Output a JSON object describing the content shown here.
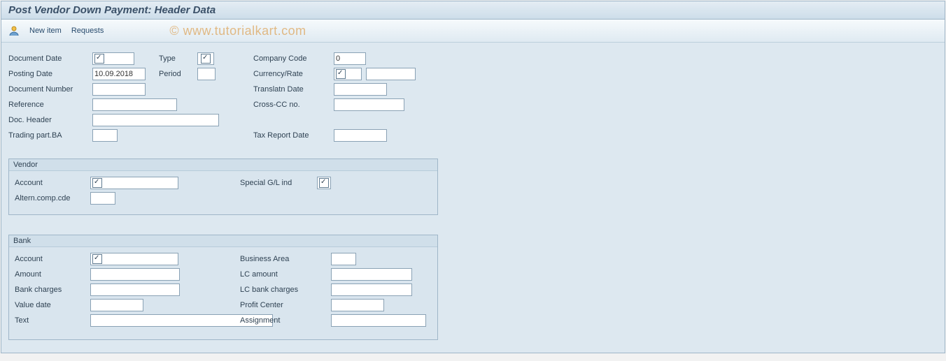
{
  "title": "Post Vendor Down Payment: Header Data",
  "watermark": "© www.tutorialkart.com",
  "toolbar": {
    "new_item": "New item",
    "requests": "Requests"
  },
  "header": {
    "document_date": {
      "label": "Document Date",
      "value": "",
      "checked": true
    },
    "posting_date": {
      "label": "Posting Date",
      "value": "10.09.2018"
    },
    "document_number": {
      "label": "Document Number",
      "value": ""
    },
    "reference": {
      "label": "Reference",
      "value": ""
    },
    "doc_header": {
      "label": "Doc. Header",
      "value": ""
    },
    "trading_part_ba": {
      "label": "Trading part.BA",
      "value": ""
    },
    "type": {
      "label": "Type",
      "value": "",
      "checked": true
    },
    "period": {
      "label": "Period",
      "value": ""
    },
    "company_code": {
      "label": "Company Code",
      "value": "0"
    },
    "currency_rate": {
      "label": "Currency/Rate",
      "value": "",
      "checked": true,
      "value2": ""
    },
    "translatn_date": {
      "label": "Translatn Date",
      "value": ""
    },
    "cross_cc_no": {
      "label": "Cross-CC no.",
      "value": ""
    },
    "tax_report_date": {
      "label": "Tax Report Date",
      "value": ""
    }
  },
  "vendor": {
    "title": "Vendor",
    "account": {
      "label": "Account",
      "value": "",
      "checked": true
    },
    "altern_comp_cde": {
      "label": "Altern.comp.cde",
      "value": ""
    },
    "special_gl_ind": {
      "label": "Special G/L ind",
      "value": "",
      "checked": true
    }
  },
  "bank": {
    "title": "Bank",
    "account": {
      "label": "Account",
      "value": "",
      "checked": true
    },
    "amount": {
      "label": "Amount",
      "value": ""
    },
    "bank_charges": {
      "label": "Bank charges",
      "value": ""
    },
    "value_date": {
      "label": "Value date",
      "value": ""
    },
    "text": {
      "label": "Text",
      "value": ""
    },
    "business_area": {
      "label": "Business Area",
      "value": ""
    },
    "lc_amount": {
      "label": "LC amount",
      "value": ""
    },
    "lc_bank_charges": {
      "label": "LC bank charges",
      "value": ""
    },
    "profit_center": {
      "label": "Profit Center",
      "value": ""
    },
    "assignment": {
      "label": "Assignment",
      "value": ""
    }
  }
}
